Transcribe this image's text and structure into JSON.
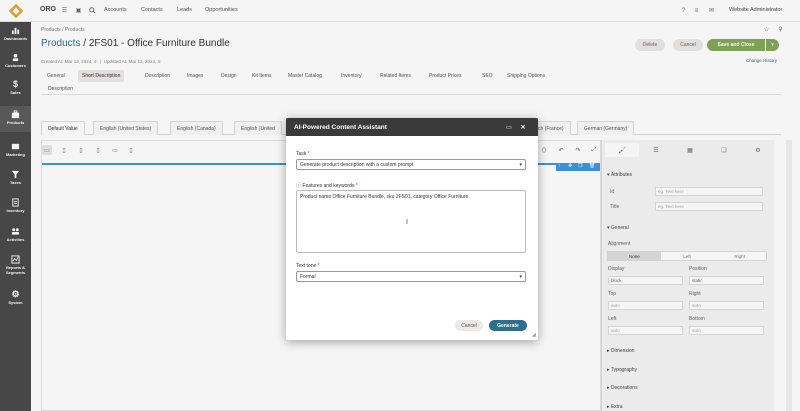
{
  "app": {
    "brand": "ORO",
    "user": "Website Administrator"
  },
  "topnav": {
    "items": [
      "Accounts",
      "Contacts",
      "Leads",
      "Opportunities"
    ]
  },
  "sidebar": {
    "items": [
      {
        "label": "Dashboards",
        "icon": "bar-chart-icon"
      },
      {
        "label": "Customers",
        "icon": "users-icon"
      },
      {
        "label": "Sales",
        "icon": "dollar-icon"
      },
      {
        "label": "Products",
        "icon": "briefcase-icon"
      },
      {
        "label": "Marketing",
        "icon": "megaphone-icon"
      },
      {
        "label": "Taxes",
        "icon": "filter-icon"
      },
      {
        "label": "Inventory",
        "icon": "clipboard-icon"
      },
      {
        "label": "Activities",
        "icon": "people-icon"
      },
      {
        "label": "Reports &",
        "icon": "report-icon"
      },
      {
        "label": "System",
        "icon": "gear-icon"
      }
    ],
    "reports_sub": "Segments"
  },
  "header": {
    "breadcrumb": "Products / Products",
    "entity": "Products",
    "separator": "/",
    "title": "2FS01 - Office Furniture Bundle",
    "created": "Created At: Mar 13, 2024, 4:",
    "updated": "Updated At: Mar 13, 2024, 4:",
    "delete_label": "Delete",
    "cancel_label": "Cancel",
    "save_close_label": "Save and Close",
    "change_history": "Change History"
  },
  "tabs": [
    "General",
    "Short Description",
    "Description",
    "Images",
    "Design",
    "Kit Items",
    "Master Catalog",
    "Inventory",
    "Related Items",
    "Product Prices",
    "SEO",
    "Shipping Options"
  ],
  "section_label": "Description",
  "locale_tabs": [
    "Default Value",
    "English (United States)",
    "English (Canada)",
    "English (United",
    "ch (France)",
    "German (Germany)"
  ],
  "right_panel": {
    "attributes": "Attributes",
    "id_label": "Id",
    "title_label": "Title",
    "placeholder": "eg. Text here",
    "general": "General",
    "alignment": "Alignment",
    "align_options": [
      "None",
      "Left",
      "Right"
    ],
    "display": "Display",
    "display_value": "block",
    "position": "Position",
    "position_value": "static",
    "top": "Top",
    "right": "Right",
    "left": "Left",
    "bottom": "Bottom",
    "auto": "auto",
    "sections": [
      "Dimension",
      "Typography",
      "Decorations",
      "Extra"
    ]
  },
  "modal": {
    "title": "AI-Powered Content Assistant",
    "task_label": "Task",
    "task_value": "Generate product description with a custom prompt",
    "features_label": "Features and keywords",
    "features_value": "Product name Office Furniture Bundle, sku 2FS01, category Office Furniture",
    "tone_label": "Text tone",
    "tone_value": "Formal",
    "required_mark": "*",
    "cancel_label": "Cancel",
    "generate_label": "Generate"
  },
  "colors": {
    "accent": "#2f6f9f",
    "green": "#84a85a",
    "sidebar": "#4a4a4a",
    "modal_head": "#3a3a3a",
    "generate": "#2e6e8e",
    "canvas_select": "#3b97e3"
  }
}
